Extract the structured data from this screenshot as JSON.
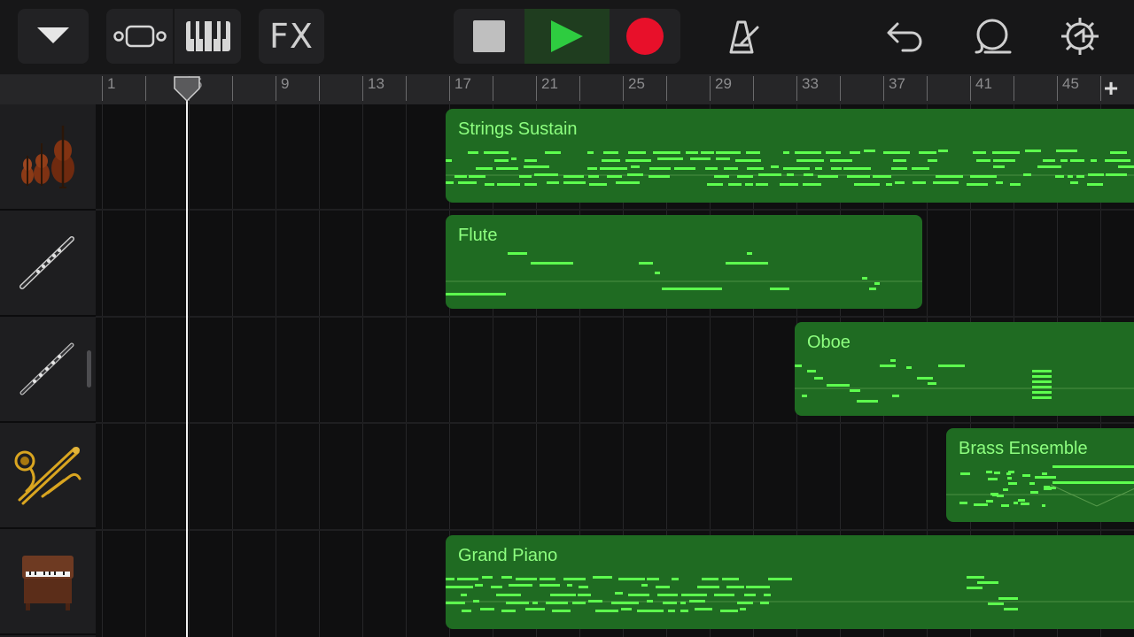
{
  "toolbar": {
    "tracks_menu_icon": "triangle-down-icon",
    "view_icon": "track-view-icon",
    "keyboard_icon": "piano-keys-icon",
    "fx_label": "FX",
    "stop_icon": "stop-icon",
    "play_icon": "play-icon",
    "record_icon": "record-icon",
    "metronome_icon": "metronome-icon",
    "undo_icon": "undo-icon",
    "loop_icon": "loop-browser-icon",
    "settings_icon": "gear-icon",
    "colors": {
      "play_active": "#2ecc40",
      "record": "#e8102a",
      "play_bg": "#1f3d1f"
    }
  },
  "ruler": {
    "bars": [
      "1",
      "5",
      "9",
      "13",
      "17",
      "21",
      "25",
      "29",
      "33",
      "37",
      "41",
      "45"
    ],
    "add_label": "+"
  },
  "tracks": [
    {
      "instrument_icon": "strings-icon"
    },
    {
      "instrument_icon": "flute-icon"
    },
    {
      "instrument_icon": "oboe-icon"
    },
    {
      "instrument_icon": "brass-icon"
    },
    {
      "instrument_icon": "organ-icon"
    }
  ],
  "regions": [
    {
      "title": "Strings Sustain",
      "track": 0
    },
    {
      "title": "Flute",
      "track": 1
    },
    {
      "title": "Oboe",
      "track": 2
    },
    {
      "title": "Brass Ensemble",
      "track": 3
    },
    {
      "title": "Grand Piano",
      "track": 4
    }
  ],
  "colors": {
    "region_fill": "#1f6b22",
    "region_text": "#8dff7f",
    "note": "#5dff4e"
  }
}
